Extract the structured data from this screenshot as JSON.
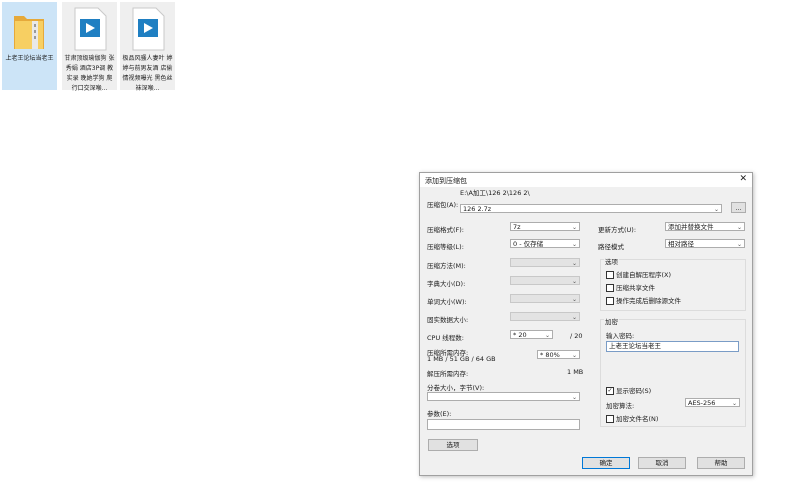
{
  "desktop": {
    "files": [
      {
        "caption": "上老王论坛当老王",
        "kind": "folder"
      },
      {
        "caption": "甘肃顶级瑜伽狗 张秀娟 酒店3P调 教实录 晚她学狗 爬行口交深喉...",
        "kind": "video"
      },
      {
        "caption": "极品风骚人妻叶 婷婷与前男友酒 店偷情视频曝光 黑色丝袜深喉...",
        "kind": "video"
      }
    ]
  },
  "dialog": {
    "title": "添加到压缩包",
    "close": "✕",
    "archive_label": "压缩包(A):",
    "archive_path": "E:\\A加工\\126 2\\126 2\\",
    "archive_name": "126 2.7z",
    "browse": "...",
    "format_label": "压缩格式(F):",
    "format_value": "7z",
    "level_label": "压缩等级(L):",
    "level_value": "0 - 仅存储",
    "method_label": "压缩方法(M):",
    "dict_label": "字典大小(D):",
    "word_label": "单词大小(W):",
    "solid_label": "固实数据大小:",
    "threads_label": "CPU 线程数:",
    "threads_value": "* 20",
    "threads_max": "/ 20",
    "mem_label": "压缩所需内存:",
    "mem_value": "1 MB / 51 GB / 64 GB",
    "mem_pct": "* 80%",
    "decomp_label": "解压所需内存:",
    "decomp_value": "1 MB",
    "split_label": "分卷大小，字节(V):",
    "params_label": "参数(E):",
    "options_button": "选项",
    "update_label": "更新方式(U):",
    "update_value": "添加并替换文件",
    "path_label": "路径模式",
    "path_value": "相对路径",
    "options_group": "选项",
    "opt_sfx": "创建自解压程序(X)",
    "opt_shared": "压缩共享文件",
    "opt_delete": "操作完成后删除源文件",
    "encrypt_group": "加密",
    "password_label": "输入密码:",
    "password_value": "上老王论坛当老王",
    "show_password": "显示密码(S)",
    "show_password_checked": "✓",
    "enc_method_label": "加密算法:",
    "enc_method_value": "AES-256",
    "encrypt_names": "加密文件名(N)",
    "ok": "确定",
    "cancel": "取消",
    "help": "帮助"
  },
  "colors": {
    "selection": "#cce4f7",
    "folder": "#f2c14e",
    "video_accent": "#1f7fc2"
  }
}
